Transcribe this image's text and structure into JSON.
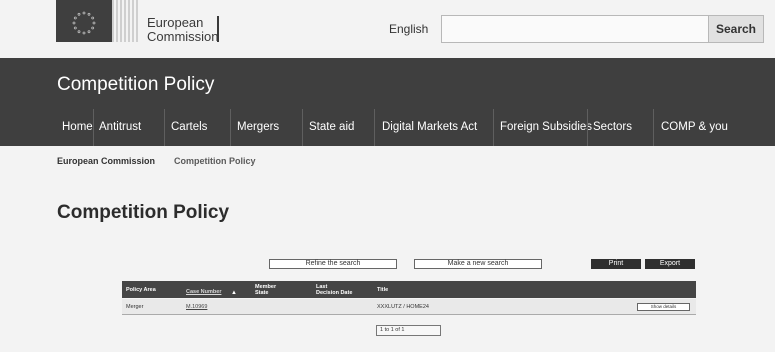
{
  "header": {
    "brand_line1": "European",
    "brand_line2": "Commission",
    "language": "English",
    "search_placeholder": "",
    "search_button": "Search"
  },
  "site_title": "Competition Policy",
  "nav": [
    "Home",
    "Antitrust",
    "Cartels",
    "Mergers",
    "State aid",
    "Digital Markets Act",
    "Foreign Subsidies",
    "Sectors",
    "COMP & you"
  ],
  "breadcrumb": [
    "European Commission",
    "Competition Policy"
  ],
  "page_title": "Competition Policy",
  "actions": {
    "refine": "Refine the search",
    "new_search": "Make a new search",
    "print": "Print",
    "export": "Export"
  },
  "table": {
    "headers": {
      "policy_area": "Policy Area",
      "case_number": "Case Number",
      "member_state_1": "Member",
      "member_state_2": "State",
      "last_decision_1": "Last",
      "last_decision_2": "Decision Date",
      "title": "Title"
    },
    "sort_icon": "sort-ascending-icon",
    "rows": [
      {
        "policy_area": "Merger",
        "case_number": "M.10969",
        "member_state": "",
        "last_decision": "",
        "title": "XXXLUTZ / HOME24",
        "details_label": "Show details"
      }
    ]
  },
  "pager": "1 to 1 of 1",
  "colors": {
    "band": "#3f3f3f",
    "table_header": "#454545",
    "button_dark": "#2f2f2f"
  }
}
